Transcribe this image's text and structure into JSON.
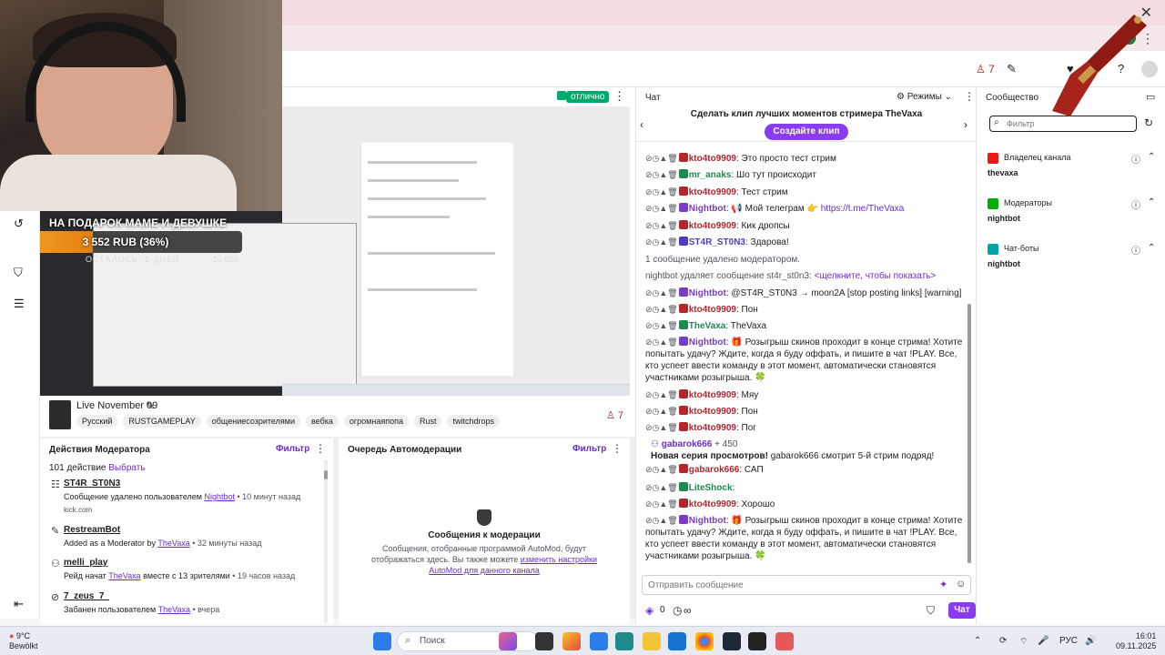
{
  "topnav": {
    "viewers": "7"
  },
  "browser": {
    "profile": "B"
  },
  "stream": {
    "quality": "отлично",
    "goal_title": "НА ПОДАРОК МАМЕ И ДЕВУШКЕ",
    "goal_amount": "3 552 RUB (36%)",
    "goal_percent": 36,
    "goal_sub": "ОСТАЛОСЬ: 1 ДНЕЙ",
    "goal_target": "10 000",
    "title": "Live November 09",
    "tags": [
      "Русский",
      "RUSTGAMEPLAY",
      "общениесозрителями",
      "вебка",
      "огромнаяпопа",
      "Rust",
      "twitchdrops"
    ],
    "viewers": "7"
  },
  "mod_actions": {
    "title": "Действия Модератора",
    "filter": "Фильтр",
    "count": "101 действие",
    "select": "Выбрать",
    "items": [
      {
        "user": "ST4R_ST0N3",
        "desc_pre": "Сообщение удалено пользователем ",
        "desc_link": "Nightbot",
        "time": " • 10 минут назад",
        "extra": "kick.com"
      },
      {
        "user": "RestreamBot",
        "desc_pre": "Added as a Moderator by ",
        "desc_link": "TheVaxa",
        "time": " • 32 минуты назад",
        "extra": ""
      },
      {
        "user": "melli_play",
        "desc_pre": "Рейд начат ",
        "desc_link": "TheVaxa",
        "desc_post": " вместе с 13 зрителями",
        "time": " • 19 часов назад",
        "extra": ""
      },
      {
        "user": "7_zeus_7_",
        "desc_pre": "Забанен пользователем ",
        "desc_link": "TheVaxa",
        "time": " • вчера",
        "extra": ""
      }
    ]
  },
  "automod": {
    "title": "Очередь Автомодерации",
    "filter": "Фильтр",
    "empty_title": "Сообщения к модерации",
    "empty_desc": "Сообщения, отобранные программой AutoMod, будут отображаться здесь. Вы также можете ",
    "empty_link": "изменить настройки AutoMod для данного канала"
  },
  "chat": {
    "title": "Чат",
    "modes": "Режимы",
    "clip_title": "Сделать клип лучших моментов стримера TheVaxa",
    "clip_button": "Создайте клип",
    "input_placeholder": "Отправить сообщение",
    "points": "0",
    "send_label": "Чат",
    "messages": [
      {
        "user": "kto4to9909",
        "text": "Это просто тест стрим",
        "color": "#b3262e"
      },
      {
        "user": "mr_anaks",
        "text": "Шо тут происходит",
        "color": "#1f8a4c"
      },
      {
        "user": "kto4to9909",
        "text": "Тест стрим",
        "color": "#b3262e"
      },
      {
        "user": "Nightbot",
        "text": "📢 Мой телеграм 👉",
        "link": "https://t.me/TheVaxa",
        "color": "#7a3cc4"
      },
      {
        "user": "kto4to9909",
        "text": "Кик дропсы",
        "color": "#b3262e"
      },
      {
        "user": "ST4R_ST0N3",
        "text": "Здарова!",
        "color": "#4c3cc4"
      },
      {
        "system": "1 сообщение удалено модератором."
      },
      {
        "system": "nightbot удаляет сообщение st4r_st0n3: ",
        "syslink": "<щелкните, чтобы показать>"
      },
      {
        "user": "Nightbot",
        "text": "@ST4R_ST0N3 → moon2A [stop posting links] [warning]",
        "color": "#7a3cc4"
      },
      {
        "user": "kto4to9909",
        "text": "Пон",
        "color": "#b3262e"
      },
      {
        "user": "TheVaxa",
        "text": "TheVaxa",
        "color": "#1f8a4c"
      },
      {
        "user": "Nightbot",
        "text": "🎁 Розыгрыш скинов проходит в конце стрима! Хотите попытать удачу? Ждите, когда я буду оффать, и пишите в чат !PLAY. Все, кто успеет ввести команду в этот момент, автоматически становятся участниками розыгрыша. 🍀",
        "color": "#7a3cc4"
      },
      {
        "user": "kto4to9909",
        "text": "Мяу",
        "color": "#b3262e"
      },
      {
        "user": "kto4to9909",
        "text": "Пон",
        "color": "#b3262e"
      },
      {
        "user": "kto4to9909",
        "text": "Пог",
        "color": "#b3262e"
      },
      {
        "user": "gabarok666",
        "points": "+ 450",
        "highlight_title": "Новая серия просмотров!",
        "highlight_text": "gabarok666 смотрит 5-й стрим подряд!"
      },
      {
        "user": "gabarok666",
        "text": "САП",
        "color": "#b3262e"
      },
      {
        "user": "LiteShock",
        "text": "",
        "color": "#1f8a4c"
      },
      {
        "user": "kto4to9909",
        "text": "Хорошо",
        "color": "#b3262e"
      },
      {
        "user": "Nightbot",
        "text": "🎁 Розыгрыш скинов проходит в конце стрима! Хотите попытать удачу? Ждите, когда я буду оффать, и пишите в чат !PLAY. Все, кто успеет ввести команду в этот момент, автоматически становятся участниками розыгрыша. 🍀",
        "color": "#7a3cc4"
      }
    ]
  },
  "community": {
    "title": "Сообщество",
    "search_placeholder": "Фильтр",
    "sections": [
      {
        "title": "Владелец канала",
        "user": "thevaxa",
        "color": "#e91916"
      },
      {
        "title": "Модераторы",
        "user": "nightbot",
        "color": "#00ad03"
      },
      {
        "title": "Чат-боты",
        "user": "nightbot",
        "color": "#00a3a3"
      }
    ]
  },
  "taskbar": {
    "temp": "9°C",
    "weather": "Bewölkt",
    "search": "Поиск",
    "lang": "РУС",
    "time": "16:01",
    "date": "09.11.2025"
  }
}
